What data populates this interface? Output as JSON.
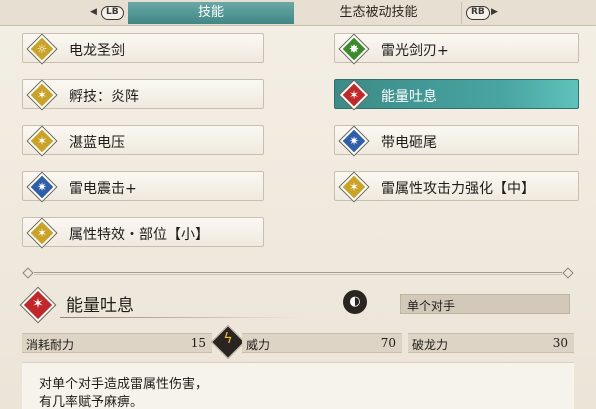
{
  "tabs": {
    "left_button": "LB",
    "right_button": "RB",
    "active": "技能",
    "inactive": "生态被动技能"
  },
  "skills_left": [
    {
      "label": "电龙圣剑",
      "color": "#c9a227",
      "glyph": "☼"
    },
    {
      "label": "孵技：炎阵",
      "color": "#c9a227",
      "glyph": "✶"
    },
    {
      "label": "湛蓝电压",
      "color": "#c9a227",
      "glyph": "✶"
    },
    {
      "label": "雷电震击+",
      "color": "#2f5fa8",
      "glyph": "✷"
    },
    {
      "label": "属性特效・部位【小】",
      "color": "#c9a227",
      "glyph": "✶"
    }
  ],
  "skills_right": [
    {
      "label": "雷光剑刃+",
      "color": "#3d8a2c",
      "glyph": "✸"
    },
    {
      "label": "能量吐息",
      "color": "#c0282a",
      "glyph": "✶",
      "selected": true
    },
    {
      "label": "带电砸尾",
      "color": "#2f5fa8",
      "glyph": "✷"
    },
    {
      "label": "雷属性攻击力强化【中】",
      "color": "#c9a227",
      "glyph": "✶"
    }
  ],
  "detail": {
    "title": "能量吐息",
    "target": "单个对手",
    "stats": [
      {
        "key": "消耗耐力",
        "value": "15"
      },
      {
        "key": "威力",
        "value": "70"
      },
      {
        "key": "破龙力",
        "value": "30"
      }
    ],
    "description_line1": "对单个对手造成雷属性伤害，",
    "description_line2": "有几率赋予麻痹。"
  }
}
